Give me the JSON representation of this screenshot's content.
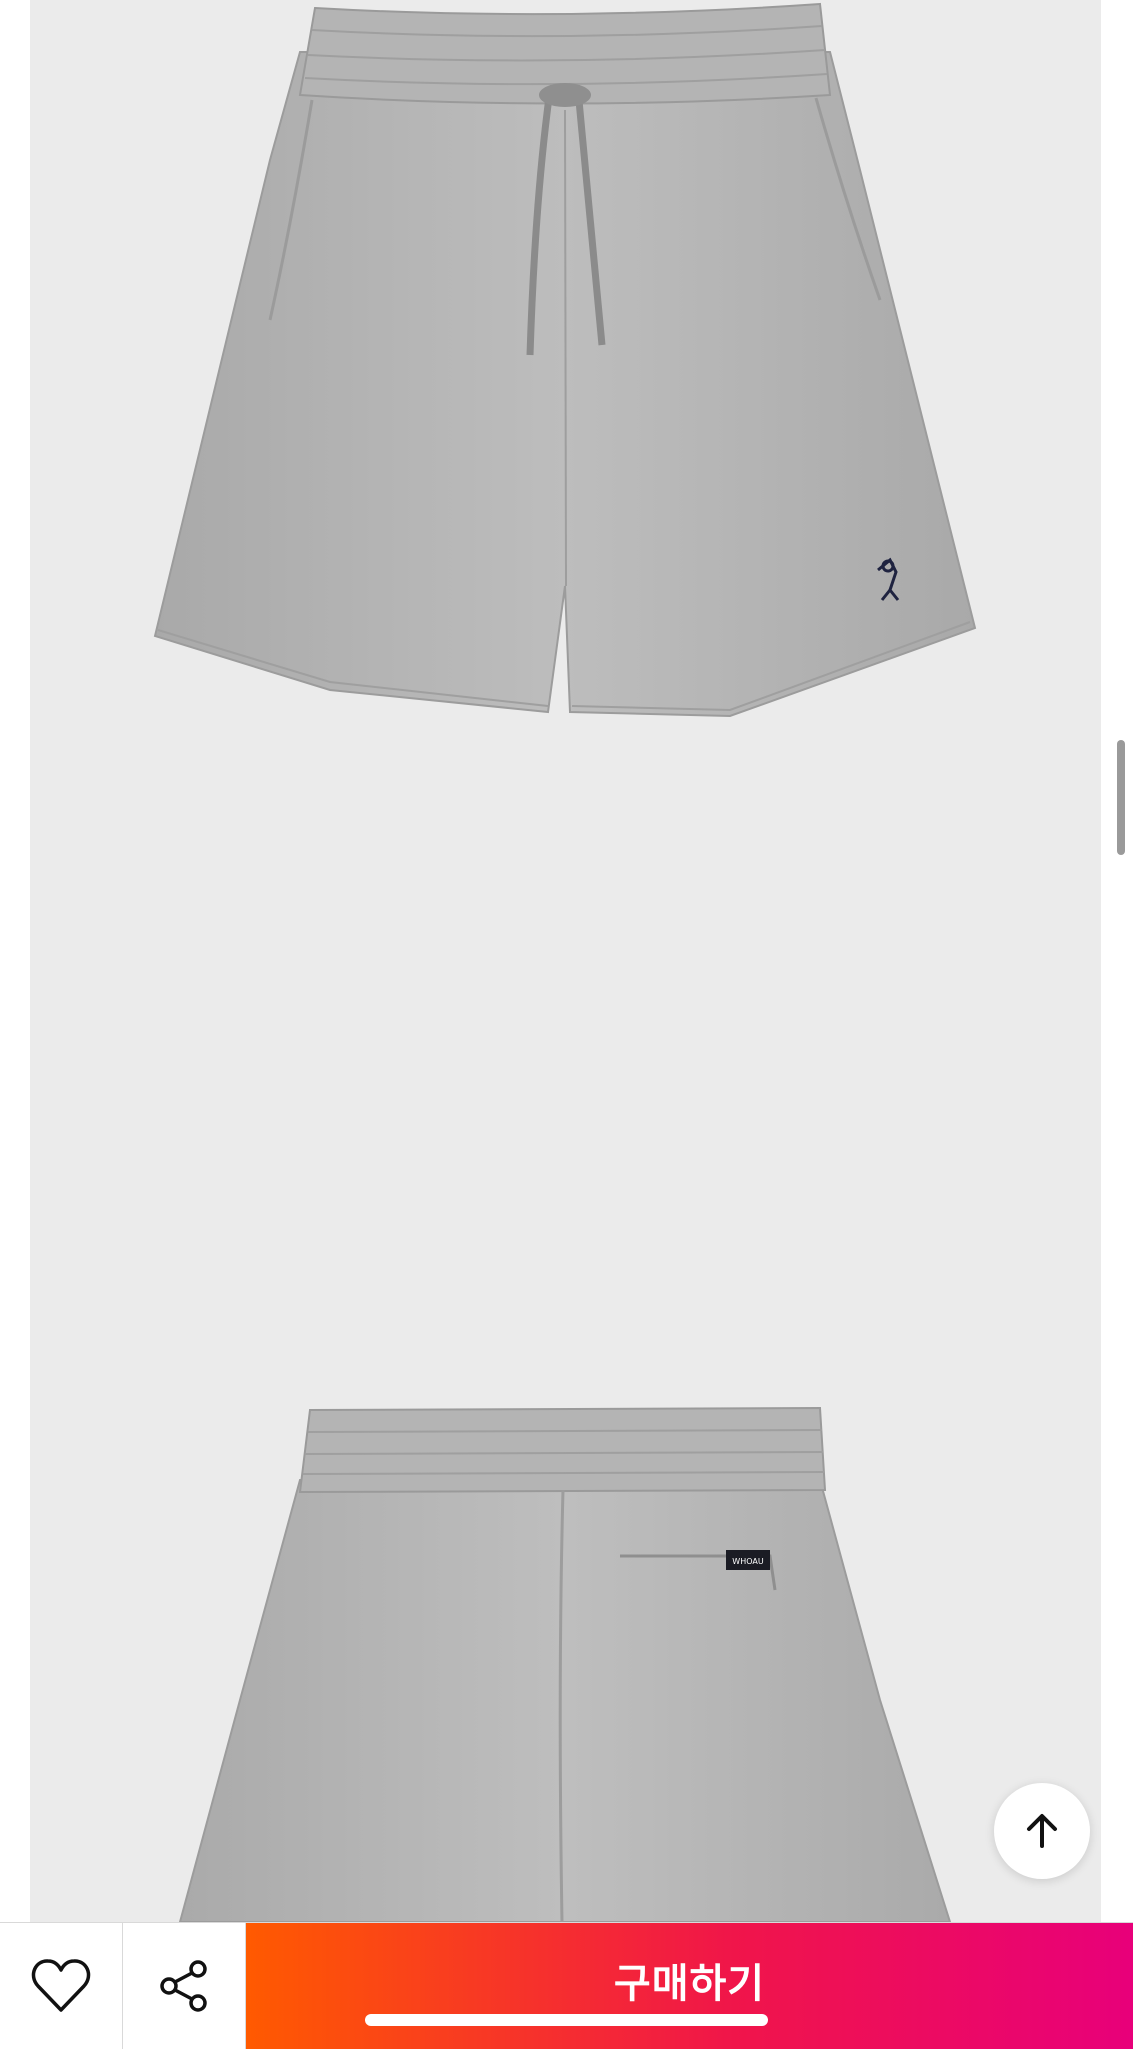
{
  "product": {
    "brand_tag": "WHOAU",
    "images": [
      {
        "name": "front-view",
        "description": "shorts-front"
      },
      {
        "name": "back-view",
        "description": "shorts-back"
      }
    ]
  },
  "actions": {
    "scroll_top_icon": "arrow-up-icon",
    "like_icon": "heart-icon",
    "share_icon": "share-icon",
    "buy_label": "구매하기"
  },
  "colors": {
    "background": "#ebebeb",
    "buy_gradient_start": "#ff5a00",
    "buy_gradient_mid": "#f0154a",
    "buy_gradient_end": "#e8007a",
    "shorts_gray": "#b6b6b6"
  }
}
